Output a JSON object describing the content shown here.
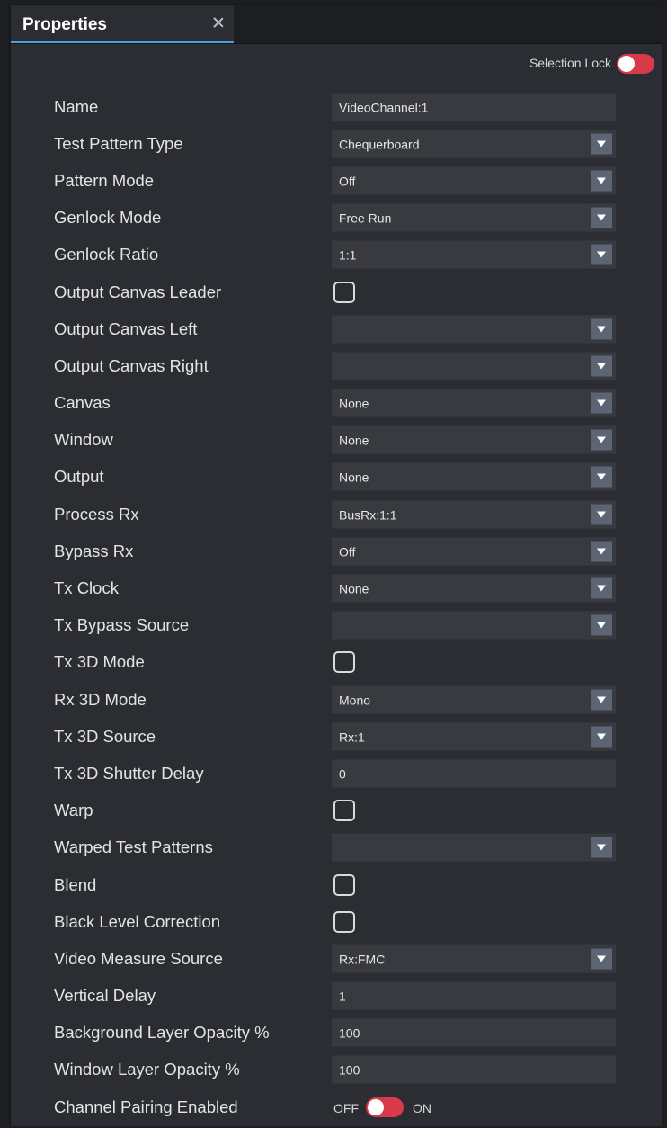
{
  "panel": {
    "tab_title": "Properties",
    "selection_lock_label": "Selection Lock",
    "selection_lock_color": "#d83a4b"
  },
  "rows": [
    {
      "label": "Name",
      "type": "text",
      "value": "VideoChannel:1"
    },
    {
      "label": "Test Pattern Type",
      "type": "select",
      "value": "Chequerboard"
    },
    {
      "label": "Pattern Mode",
      "type": "select",
      "value": "Off"
    },
    {
      "label": "Genlock Mode",
      "type": "select",
      "value": "Free Run"
    },
    {
      "label": "Genlock Ratio",
      "type": "select",
      "value": "1:1"
    },
    {
      "label": "Output Canvas Leader",
      "type": "checkbox",
      "checked": false
    },
    {
      "label": "Output Canvas Left",
      "type": "select",
      "value": ""
    },
    {
      "label": "Output Canvas Right",
      "type": "select",
      "value": ""
    },
    {
      "label": "Canvas",
      "type": "select",
      "value": "None"
    },
    {
      "label": "Window",
      "type": "select",
      "value": "None"
    },
    {
      "label": "Output",
      "type": "select",
      "value": "None"
    },
    {
      "label": "Process Rx",
      "type": "select",
      "value": "BusRx:1:1"
    },
    {
      "label": "Bypass Rx",
      "type": "select",
      "value": "Off"
    },
    {
      "label": "Tx Clock",
      "type": "select",
      "value": "None"
    },
    {
      "label": "Tx Bypass Source",
      "type": "select",
      "value": ""
    },
    {
      "label": "Tx 3D Mode",
      "type": "checkbox",
      "checked": false
    },
    {
      "label": "Rx 3D Mode",
      "type": "select",
      "value": "Mono"
    },
    {
      "label": "Tx 3D Source",
      "type": "select",
      "value": "Rx:1"
    },
    {
      "label": "Tx 3D Shutter Delay",
      "type": "text",
      "value": "0"
    },
    {
      "label": "Warp",
      "type": "checkbox",
      "checked": false
    },
    {
      "label": "Warped Test Patterns",
      "type": "select",
      "value": ""
    },
    {
      "label": "Blend",
      "type": "checkbox",
      "checked": false
    },
    {
      "label": "Black Level Correction",
      "type": "checkbox",
      "checked": false
    },
    {
      "label": "Video Measure Source",
      "type": "select",
      "value": "Rx:FMC"
    },
    {
      "label": "Vertical Delay",
      "type": "text",
      "value": "1"
    },
    {
      "label": "Background Layer Opacity %",
      "type": "text",
      "value": "100"
    },
    {
      "label": "Window Layer Opacity %",
      "type": "text",
      "value": "100"
    },
    {
      "label": "Channel Pairing Enabled",
      "type": "switch",
      "off_label": "OFF",
      "on_label": "ON"
    }
  ]
}
